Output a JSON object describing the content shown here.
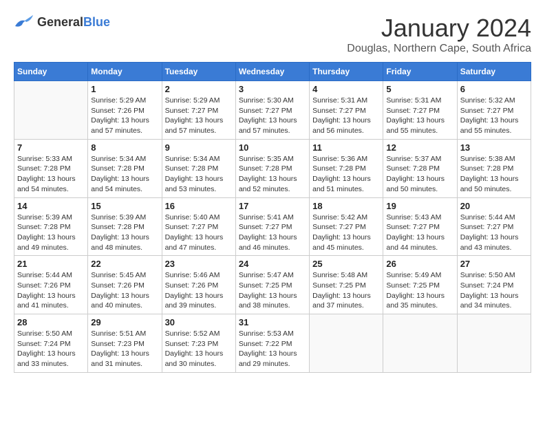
{
  "logo": {
    "general": "General",
    "blue": "Blue"
  },
  "title": "January 2024",
  "location": "Douglas, Northern Cape, South Africa",
  "days_header": [
    "Sunday",
    "Monday",
    "Tuesday",
    "Wednesday",
    "Thursday",
    "Friday",
    "Saturday"
  ],
  "weeks": [
    [
      {
        "day": "",
        "info": ""
      },
      {
        "day": "1",
        "info": "Sunrise: 5:29 AM\nSunset: 7:26 PM\nDaylight: 13 hours\nand 57 minutes."
      },
      {
        "day": "2",
        "info": "Sunrise: 5:29 AM\nSunset: 7:27 PM\nDaylight: 13 hours\nand 57 minutes."
      },
      {
        "day": "3",
        "info": "Sunrise: 5:30 AM\nSunset: 7:27 PM\nDaylight: 13 hours\nand 57 minutes."
      },
      {
        "day": "4",
        "info": "Sunrise: 5:31 AM\nSunset: 7:27 PM\nDaylight: 13 hours\nand 56 minutes."
      },
      {
        "day": "5",
        "info": "Sunrise: 5:31 AM\nSunset: 7:27 PM\nDaylight: 13 hours\nand 55 minutes."
      },
      {
        "day": "6",
        "info": "Sunrise: 5:32 AM\nSunset: 7:27 PM\nDaylight: 13 hours\nand 55 minutes."
      }
    ],
    [
      {
        "day": "7",
        "info": "Sunrise: 5:33 AM\nSunset: 7:28 PM\nDaylight: 13 hours\nand 54 minutes."
      },
      {
        "day": "8",
        "info": "Sunrise: 5:34 AM\nSunset: 7:28 PM\nDaylight: 13 hours\nand 54 minutes."
      },
      {
        "day": "9",
        "info": "Sunrise: 5:34 AM\nSunset: 7:28 PM\nDaylight: 13 hours\nand 53 minutes."
      },
      {
        "day": "10",
        "info": "Sunrise: 5:35 AM\nSunset: 7:28 PM\nDaylight: 13 hours\nand 52 minutes."
      },
      {
        "day": "11",
        "info": "Sunrise: 5:36 AM\nSunset: 7:28 PM\nDaylight: 13 hours\nand 51 minutes."
      },
      {
        "day": "12",
        "info": "Sunrise: 5:37 AM\nSunset: 7:28 PM\nDaylight: 13 hours\nand 50 minutes."
      },
      {
        "day": "13",
        "info": "Sunrise: 5:38 AM\nSunset: 7:28 PM\nDaylight: 13 hours\nand 50 minutes."
      }
    ],
    [
      {
        "day": "14",
        "info": "Sunrise: 5:39 AM\nSunset: 7:28 PM\nDaylight: 13 hours\nand 49 minutes."
      },
      {
        "day": "15",
        "info": "Sunrise: 5:39 AM\nSunset: 7:28 PM\nDaylight: 13 hours\nand 48 minutes."
      },
      {
        "day": "16",
        "info": "Sunrise: 5:40 AM\nSunset: 7:27 PM\nDaylight: 13 hours\nand 47 minutes."
      },
      {
        "day": "17",
        "info": "Sunrise: 5:41 AM\nSunset: 7:27 PM\nDaylight: 13 hours\nand 46 minutes."
      },
      {
        "day": "18",
        "info": "Sunrise: 5:42 AM\nSunset: 7:27 PM\nDaylight: 13 hours\nand 45 minutes."
      },
      {
        "day": "19",
        "info": "Sunrise: 5:43 AM\nSunset: 7:27 PM\nDaylight: 13 hours\nand 44 minutes."
      },
      {
        "day": "20",
        "info": "Sunrise: 5:44 AM\nSunset: 7:27 PM\nDaylight: 13 hours\nand 43 minutes."
      }
    ],
    [
      {
        "day": "21",
        "info": "Sunrise: 5:44 AM\nSunset: 7:26 PM\nDaylight: 13 hours\nand 41 minutes."
      },
      {
        "day": "22",
        "info": "Sunrise: 5:45 AM\nSunset: 7:26 PM\nDaylight: 13 hours\nand 40 minutes."
      },
      {
        "day": "23",
        "info": "Sunrise: 5:46 AM\nSunset: 7:26 PM\nDaylight: 13 hours\nand 39 minutes."
      },
      {
        "day": "24",
        "info": "Sunrise: 5:47 AM\nSunset: 7:25 PM\nDaylight: 13 hours\nand 38 minutes."
      },
      {
        "day": "25",
        "info": "Sunrise: 5:48 AM\nSunset: 7:25 PM\nDaylight: 13 hours\nand 37 minutes."
      },
      {
        "day": "26",
        "info": "Sunrise: 5:49 AM\nSunset: 7:25 PM\nDaylight: 13 hours\nand 35 minutes."
      },
      {
        "day": "27",
        "info": "Sunrise: 5:50 AM\nSunset: 7:24 PM\nDaylight: 13 hours\nand 34 minutes."
      }
    ],
    [
      {
        "day": "28",
        "info": "Sunrise: 5:50 AM\nSunset: 7:24 PM\nDaylight: 13 hours\nand 33 minutes."
      },
      {
        "day": "29",
        "info": "Sunrise: 5:51 AM\nSunset: 7:23 PM\nDaylight: 13 hours\nand 31 minutes."
      },
      {
        "day": "30",
        "info": "Sunrise: 5:52 AM\nSunset: 7:23 PM\nDaylight: 13 hours\nand 30 minutes."
      },
      {
        "day": "31",
        "info": "Sunrise: 5:53 AM\nSunset: 7:22 PM\nDaylight: 13 hours\nand 29 minutes."
      },
      {
        "day": "",
        "info": ""
      },
      {
        "day": "",
        "info": ""
      },
      {
        "day": "",
        "info": ""
      }
    ]
  ]
}
